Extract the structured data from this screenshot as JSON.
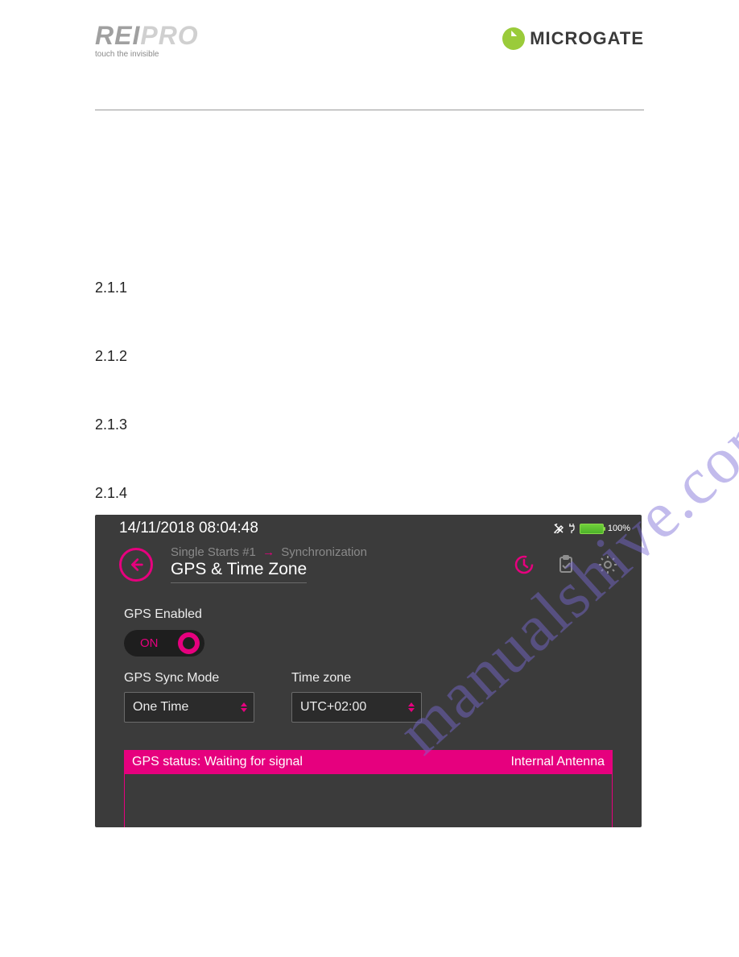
{
  "logos": {
    "left_main_a": "REI",
    "left_main_b": "PRO",
    "left_tag": "touch the invisible",
    "right": "MICROGATE"
  },
  "sections": [
    "2.1.1",
    "2.1.2",
    "2.1.3",
    "2.1.4"
  ],
  "device": {
    "datetime": "14/11/2018  08:04:48",
    "battery_pct": "100%",
    "breadcrumb_a": "Single Starts #1",
    "breadcrumb_b": "Synchronization",
    "title": "GPS & Time Zone",
    "gps_enabled_label": "GPS Enabled",
    "toggle_state": "ON",
    "sync_mode_label": "GPS Sync Mode",
    "sync_mode_value": "One Time",
    "tz_label": "Time zone",
    "tz_value": "UTC+02:00",
    "status_text": "GPS status: Waiting for signal",
    "antenna_text": "Internal Antenna"
  },
  "watermark": "manualshive.com"
}
